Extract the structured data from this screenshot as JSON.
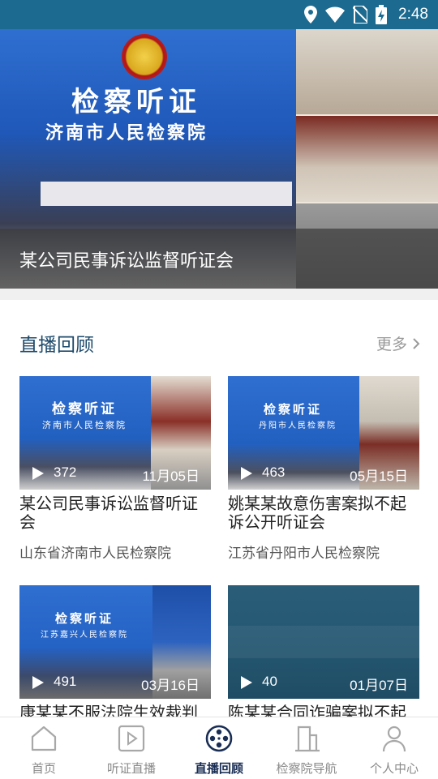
{
  "status_bar": {
    "time": "2:48"
  },
  "hero": {
    "caption": "某公司民事诉讼监督听证会",
    "sign_line1": "检察听证",
    "sign_line2": "济南市人民检察院"
  },
  "section": {
    "title": "直播回顾",
    "more": "更多"
  },
  "cards": [
    {
      "views": "372",
      "date": "11月05日",
      "title": "某公司民事诉讼监督听证会",
      "org": "山东省济南市人民检察院",
      "thumb_sign1": "检察听证",
      "thumb_sign2": "济南市人民检察院"
    },
    {
      "views": "463",
      "date": "05月15日",
      "title": "姚某某故意伤害案拟不起诉公开听证会",
      "org": "江苏省丹阳市人民检察院",
      "thumb_sign1": "检察听证",
      "thumb_sign2": "丹阳市人民检察院"
    },
    {
      "views": "491",
      "date": "03月16日",
      "title": "康某某不服法院生效裁判",
      "org": "",
      "thumb_sign1": "检察听证",
      "thumb_sign2": "江苏嘉兴人民检察院"
    },
    {
      "views": "40",
      "date": "01月07日",
      "title": "陈某某合同诈骗案拟不起",
      "org": "",
      "thumb_sign1": "",
      "thumb_sign2": ""
    }
  ],
  "tabs": [
    {
      "label": "首页",
      "icon": "home-icon"
    },
    {
      "label": "听证直播",
      "icon": "live-icon"
    },
    {
      "label": "直播回顾",
      "icon": "film-reel-icon"
    },
    {
      "label": "检察院导航",
      "icon": "building-icon"
    },
    {
      "label": "个人中心",
      "icon": "person-icon"
    }
  ],
  "colors": {
    "status_bar": "#1c6a8f",
    "section_title": "#1d4a6b",
    "tab_active": "#1a2e55",
    "tab_inactive": "#8a8a8a"
  }
}
